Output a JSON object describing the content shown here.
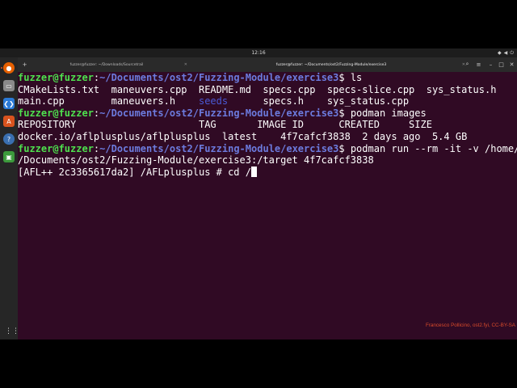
{
  "topbar": {
    "clock": "12:16"
  },
  "terminal_tabs": [
    {
      "label": "fuzzer@fuzzer: ~/Downloads/Sourcetrail"
    },
    {
      "label": "fuzzer@fuzzer: ~/Documents/ost2/Fuzzing-Module/exercise3"
    }
  ],
  "colors": {
    "background": "#300a24",
    "prompt_user": "#4ee04e",
    "prompt_path": "#6c7bde",
    "dir_listing": "#4a5ad6",
    "watermark": "#d94b2b"
  },
  "dock_icons": [
    "firefox-icon",
    "files-icon",
    "vscode-icon",
    "software-icon",
    "help-icon",
    "trash-icon",
    "show-apps-icon"
  ],
  "prompt": {
    "user": "fuzzer@fuzzer",
    "path": "~/Documents/ost2/Fuzzing-Module/exercise3",
    "sep": ":",
    "dollar": "$"
  },
  "lines": {
    "l1_cmd": " ls",
    "l2": "CMakeLists.txt  maneuvers.cpp  README.md  specs.cpp  specs-slice.cpp  sys_status.h",
    "l3a": "main.cpp        maneuvers.h    ",
    "l3b": "seeds",
    "l3c": "      specs.h    sys_status.cpp",
    "l4_cmd": " podman images",
    "l5": "REPOSITORY                     TAG       IMAGE ID      CREATED     SIZE",
    "l6": "docker.io/aflplusplus/aflplusplus  latest    4f7cafcf3838  2 days ago  5.4 GB",
    "l7_cmd": " podman run --rm -it -v /home/fuzzer",
    "l8": "/Documents/ost2/Fuzzing-Module/exercise3:/target 4f7cafcf3838",
    "l9": "[AFL++ 2c3365617da2] /AFLplusplus # cd /"
  },
  "watermark": "Francesco Pollicino, ost2.fyi, CC-BY-SA"
}
